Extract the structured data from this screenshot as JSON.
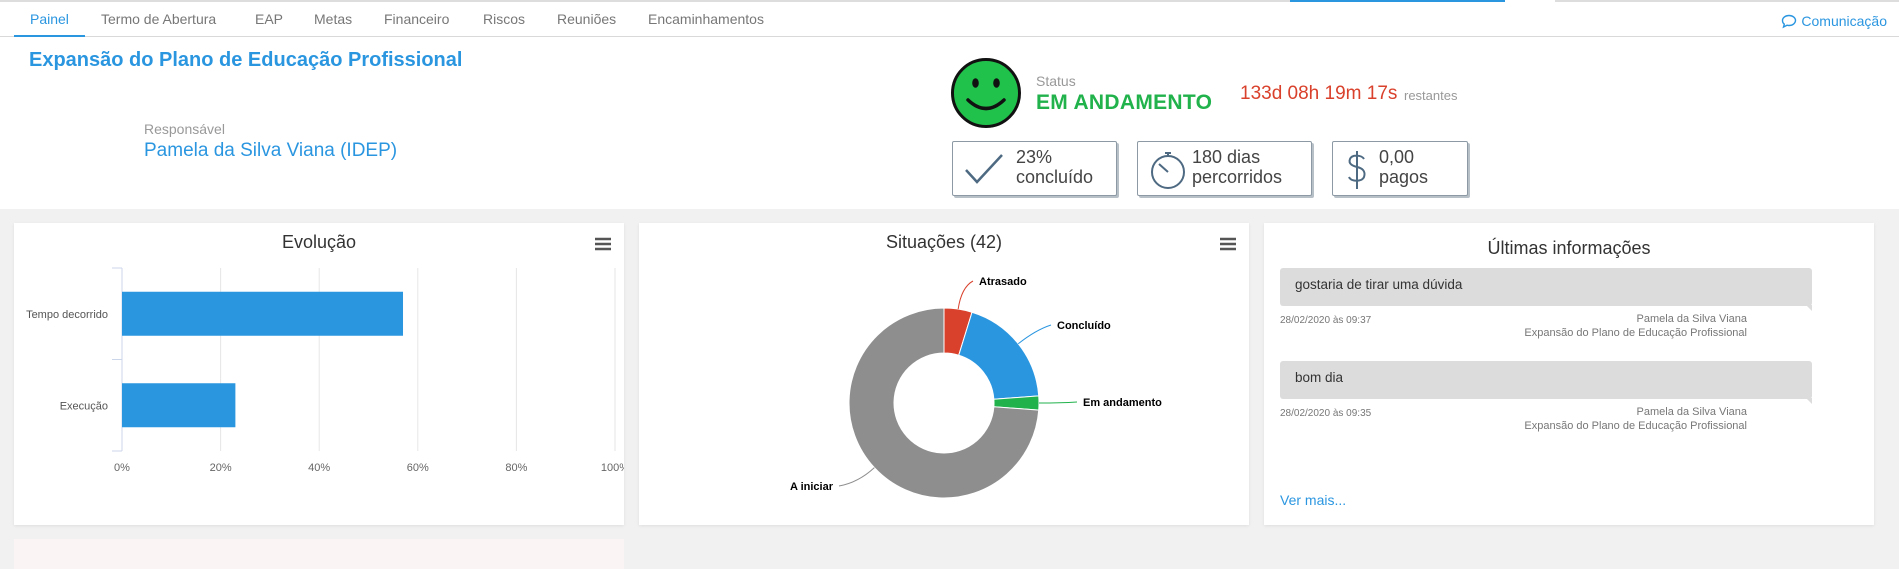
{
  "tabs": [
    "Painel",
    "Termo de Abertura",
    "EAP",
    "Metas",
    "Financeiro",
    "Riscos",
    "Reuniões",
    "Encaminhamentos"
  ],
  "communication_label": "Comunicação",
  "project": {
    "title": "Expansão do Plano de Educação Profissional",
    "responsible_label": "Responsável",
    "responsible_name": "Pamela da Silva Viana (IDEP)"
  },
  "status": {
    "label": "Status",
    "value": "EM ANDAMENTO",
    "time_left": "133d 08h 19m 17s",
    "time_left_suffix": "restantes",
    "color": "#21b24c"
  },
  "kpis": [
    {
      "icon": "check-icon",
      "value": "23%",
      "unit": "",
      "caption": "concluído"
    },
    {
      "icon": "stopwatch-icon",
      "value": "180",
      "unit": " dias",
      "caption": "percorridos"
    },
    {
      "icon": "dollar-icon",
      "value": "0,00",
      "unit": "",
      "caption": "pagos"
    }
  ],
  "chart_data": [
    {
      "type": "bar",
      "title": "Evolução",
      "orientation": "horizontal",
      "categories": [
        "Tempo decorrido",
        "Execução"
      ],
      "values": [
        57,
        23
      ],
      "xlim": [
        0,
        100
      ],
      "x_ticks": [
        "0%",
        "20%",
        "40%",
        "60%",
        "80%",
        "100%"
      ],
      "color": "#2b96e0",
      "grid": true
    },
    {
      "type": "pie",
      "title": "Situações (42)",
      "donut": true,
      "slices": [
        {
          "label": "Atrasado",
          "value": 2,
          "color": "#d9412c"
        },
        {
          "label": "Concluído",
          "value": 8,
          "color": "#2b96e0"
        },
        {
          "label": "Em andamento",
          "value": 1,
          "color": "#21b24c"
        },
        {
          "label": "A iniciar",
          "value": 31,
          "color": "#8e8e8e"
        }
      ]
    }
  ],
  "latest": {
    "title": "Últimas informações",
    "messages": [
      {
        "text": "gostaria de tirar uma dúvida",
        "date": "28/02/2020 às 09:37",
        "author": "Pamela da Silva Viana",
        "project": "Expansão do Plano de Educação Profissional"
      },
      {
        "text": "bom dia",
        "date": "28/02/2020 às 09:35",
        "author": "Pamela da Silva Viana",
        "project": "Expansão do Plano de Educação Profissional"
      }
    ],
    "more_label": "Ver mais..."
  }
}
